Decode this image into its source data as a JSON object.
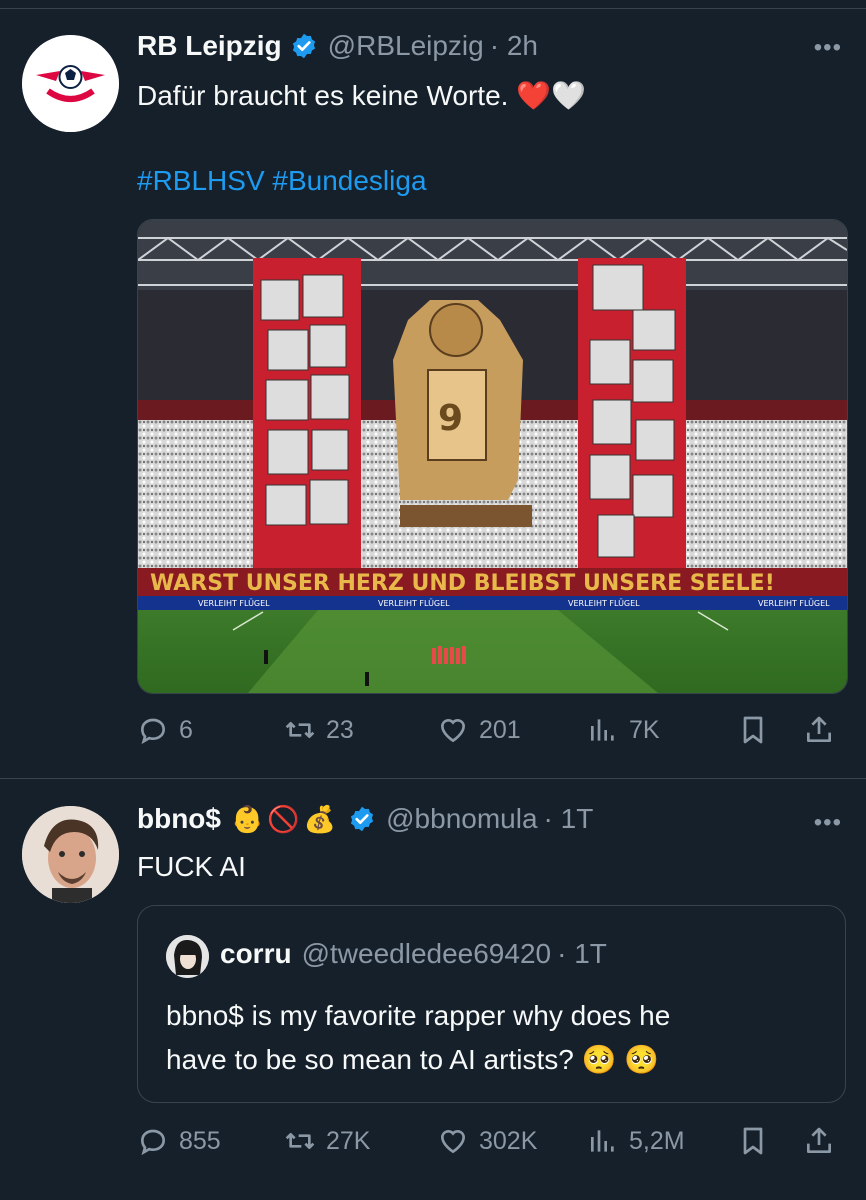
{
  "tweet1": {
    "author": "RB Leipzig",
    "handle": "@RBLeipzig",
    "time": "· 2h",
    "text": "Dafür braucht es keine Worte. ❤️🤍",
    "hashtags": "#RBLHSV #Bundesliga",
    "banner_text": "WARST UNSER HERZ UND BLEIBST UNSERE SEELE!",
    "ad_text": "VERLEIHT FLÜGEL",
    "actions": {
      "replies": "6",
      "retweets": "23",
      "likes": "201",
      "views": "7K"
    }
  },
  "tweet2": {
    "author": "bbno$",
    "emojis": "👶🚫💰",
    "handle": "@bbnomula",
    "time": "· 1T",
    "text": "FUCK AI",
    "quote": {
      "author": "corru",
      "handle": "@tweedledee69420",
      "time": "· 1T",
      "line1": "bbno$ is my favorite rapper why does he",
      "line2": "have to be so mean to AI artists? 🥺 🥺"
    },
    "actions": {
      "replies": "855",
      "retweets": "27K",
      "likes": "302K",
      "views": "5,2M"
    }
  },
  "colors": {
    "background": "#15202b",
    "link": "#1d9bf0",
    "muted": "#8b98a5",
    "verified": "#1d9bf0",
    "brand_red": "#dd0741"
  },
  "icons": [
    "more-icon",
    "verified-icon",
    "reply-icon",
    "retweet-icon",
    "like-icon",
    "views-icon",
    "bookmark-icon",
    "share-icon"
  ]
}
